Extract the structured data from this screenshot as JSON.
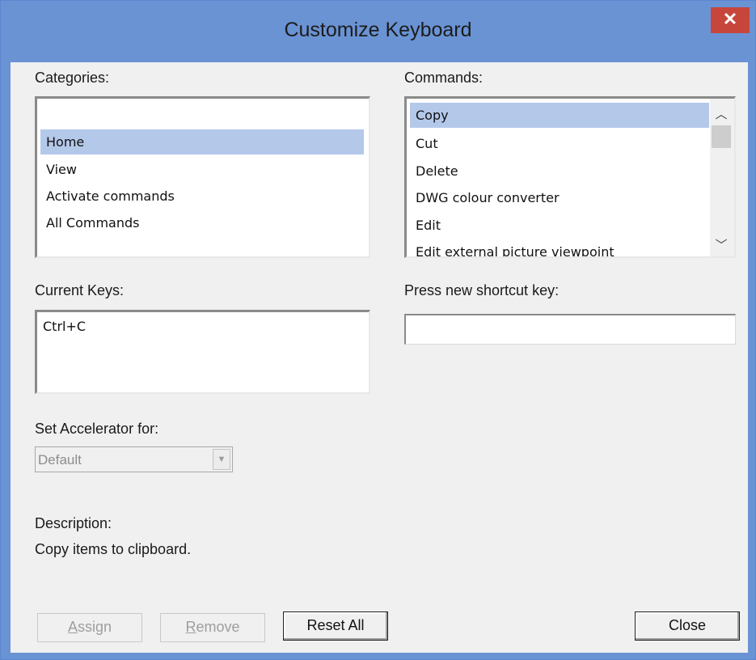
{
  "window": {
    "title": "Customize Keyboard",
    "close_glyph": "✕"
  },
  "categories": {
    "label": "Categories:",
    "items": [
      "Home",
      "View",
      "Activate commands",
      "All Commands"
    ],
    "selected": "Home"
  },
  "commands": {
    "label": "Commands:",
    "items": [
      "Copy",
      "Cut",
      "Delete",
      "DWG colour converter",
      "Edit",
      "Edit external picture viewpoint"
    ],
    "selected": "Copy"
  },
  "current_keys": {
    "label": "Current Keys:",
    "items": [
      "Ctrl+C"
    ]
  },
  "new_shortcut": {
    "label": "Press new shortcut key:",
    "value": ""
  },
  "accelerator": {
    "label": "Set Accelerator for:",
    "value": "Default"
  },
  "description": {
    "label": "Description:",
    "text": "Copy items to clipboard."
  },
  "buttons": {
    "assign_mnemonic": "A",
    "assign_rest": "ssign",
    "remove_mnemonic": "R",
    "remove_rest": "emove",
    "reset_all": "Reset All",
    "close": "Close"
  },
  "icons": {
    "scroll_up": "chevron-up-icon",
    "scroll_down": "chevron-down-icon",
    "combo_arrow": "triangle-down-icon"
  },
  "colors": {
    "title_bar": "#6a93d4",
    "close_button": "#c7463b",
    "selection": "#b4c8ea",
    "dialog_bg": "#f0f0f0"
  }
}
